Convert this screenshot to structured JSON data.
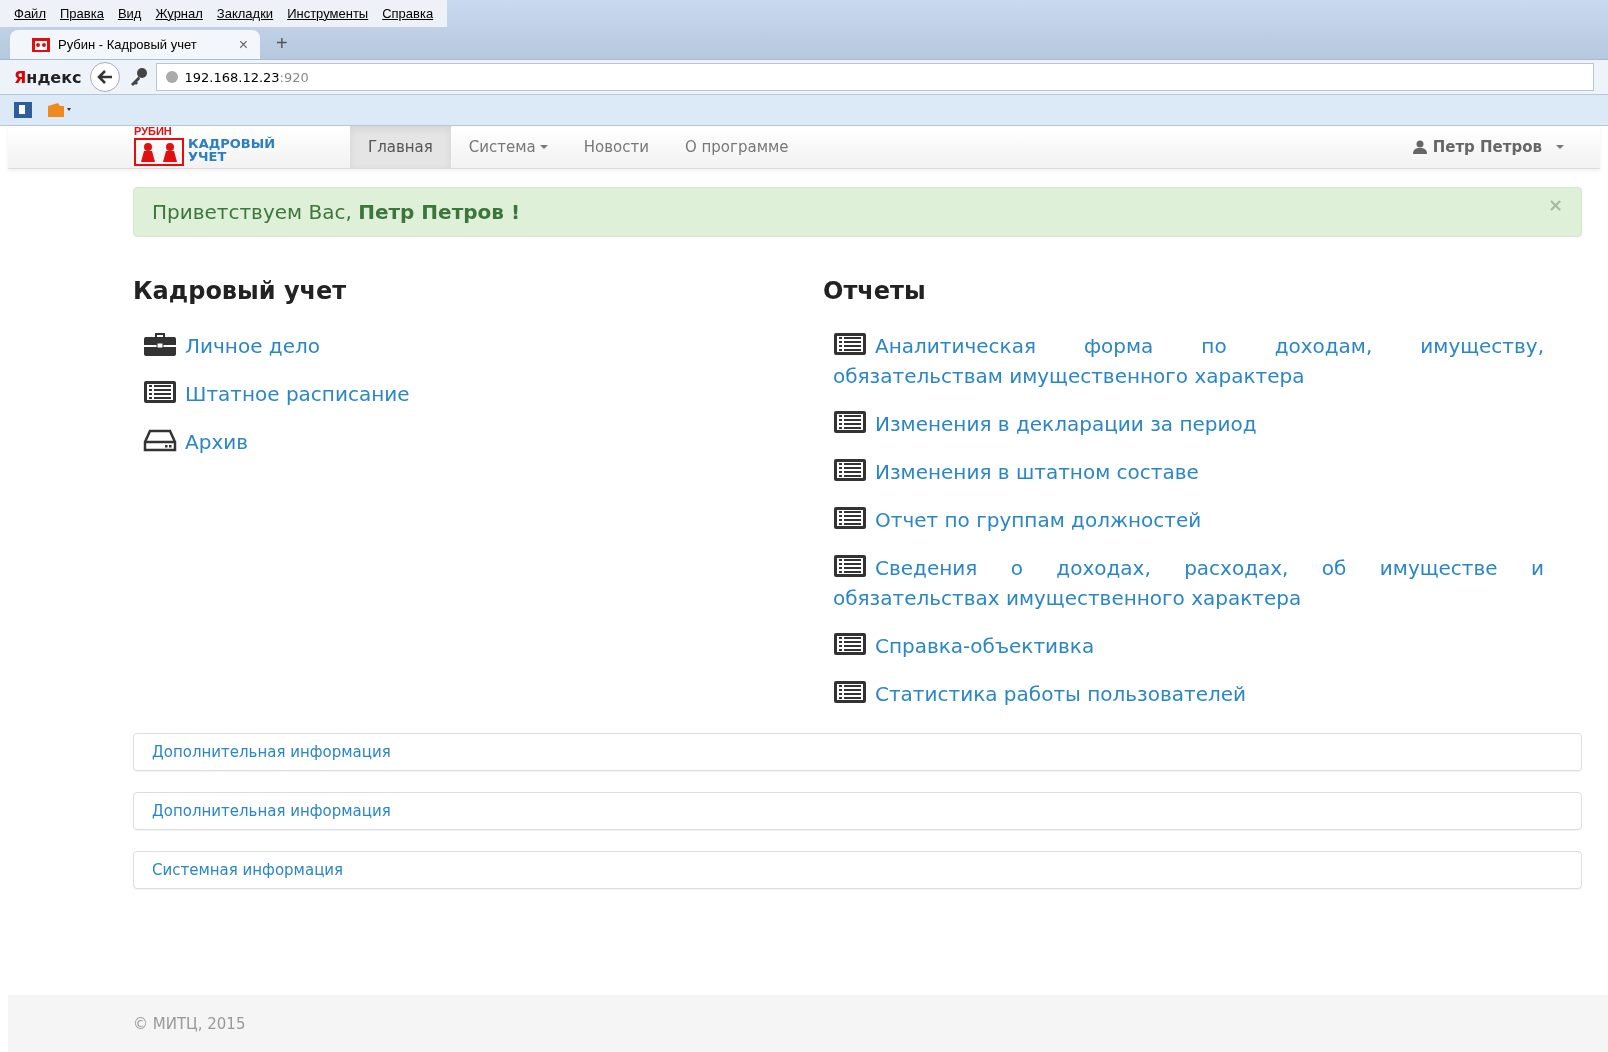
{
  "browser": {
    "menu": [
      "Файл",
      "Правка",
      "Вид",
      "Журнал",
      "Закладки",
      "Инструменты",
      "Справка"
    ],
    "tab": {
      "title": "Рубин - Кадровый учет",
      "close": "×"
    },
    "new_tab": "+",
    "search_brand": "Яндекс",
    "address": {
      "host": "192.168.12.23",
      "port": ":920"
    }
  },
  "navbar": {
    "logo": {
      "top": "РУБИН",
      "line1": "КАДРОВЫЙ",
      "line2": "УЧЕТ"
    },
    "items": [
      {
        "label": "Главная",
        "selected": true,
        "dropdown": false
      },
      {
        "label": "Система",
        "selected": false,
        "dropdown": true
      },
      {
        "label": "Новости",
        "selected": false,
        "dropdown": false
      },
      {
        "label": "О программе",
        "selected": false,
        "dropdown": false
      }
    ],
    "user": "Петр Петров"
  },
  "alert": {
    "text": "Приветствуем Вас, **Петр Петров !**",
    "close": "×"
  },
  "hr_section": {
    "title": "Кадровый учет",
    "links": [
      {
        "label": "Личное дело",
        "kind": "briefcase"
      },
      {
        "label": "Штатное расписание",
        "kind": "list"
      },
      {
        "label": "Архив",
        "kind": "drive"
      }
    ]
  },
  "reports": {
    "title": "Отчеты",
    "links": [
      {
        "label": "Аналитическая форма по доходам, имуществу, обязательствам имущественного характера",
        "kind": "list"
      },
      {
        "label": "Изменения в декларации за период",
        "kind": "list"
      },
      {
        "label": "Изменения в штатном составе",
        "kind": "list"
      },
      {
        "label": "Отчет по группам должностей",
        "kind": "list"
      },
      {
        "label": "Сведения о доходах, расходах, об имуществе и обязательствах имущественного характера",
        "kind": "list"
      },
      {
        "label": "Справка-объективка",
        "kind": "list"
      },
      {
        "label": "Статистика работы пользователей",
        "kind": "list"
      }
    ]
  },
  "panels": [
    "Дополнительная информация",
    "Дополнительная информация",
    "Системная информация"
  ],
  "footer": "© МИТЦ, 2015"
}
